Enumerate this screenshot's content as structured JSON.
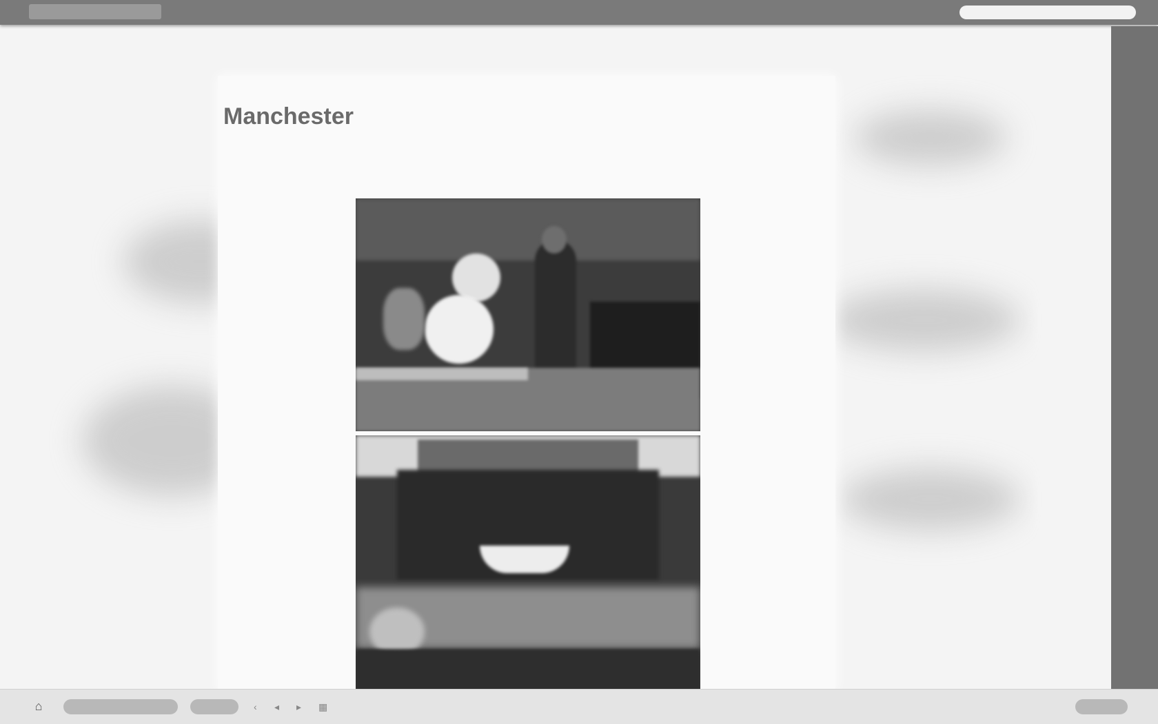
{
  "header": {
    "logo_text": "",
    "nav": [
      {
        "label": "",
        "active": true
      },
      {
        "label": "",
        "active": false
      },
      {
        "label": "",
        "active": false
      },
      {
        "label": "",
        "active": false
      },
      {
        "label": "",
        "active": false
      },
      {
        "label": "",
        "active": false
      },
      {
        "label": "",
        "active": false
      },
      {
        "label": "",
        "active": false
      }
    ],
    "search_placeholder": ""
  },
  "article": {
    "breadcrumb": [
      "",
      "",
      ""
    ],
    "title": "Manchester",
    "pager": {
      "current": "",
      "total": ""
    },
    "description": ""
  },
  "sidebar": {
    "items": [
      "",
      "",
      "",
      "",
      "",
      "",
      ""
    ]
  },
  "bottombar": {
    "primary_label": "",
    "secondary_label": "",
    "status": "",
    "end_label": ""
  },
  "colors": {
    "topbar": "#7a7a7a",
    "sidebar": "#727272",
    "panel": "#fafafa"
  }
}
